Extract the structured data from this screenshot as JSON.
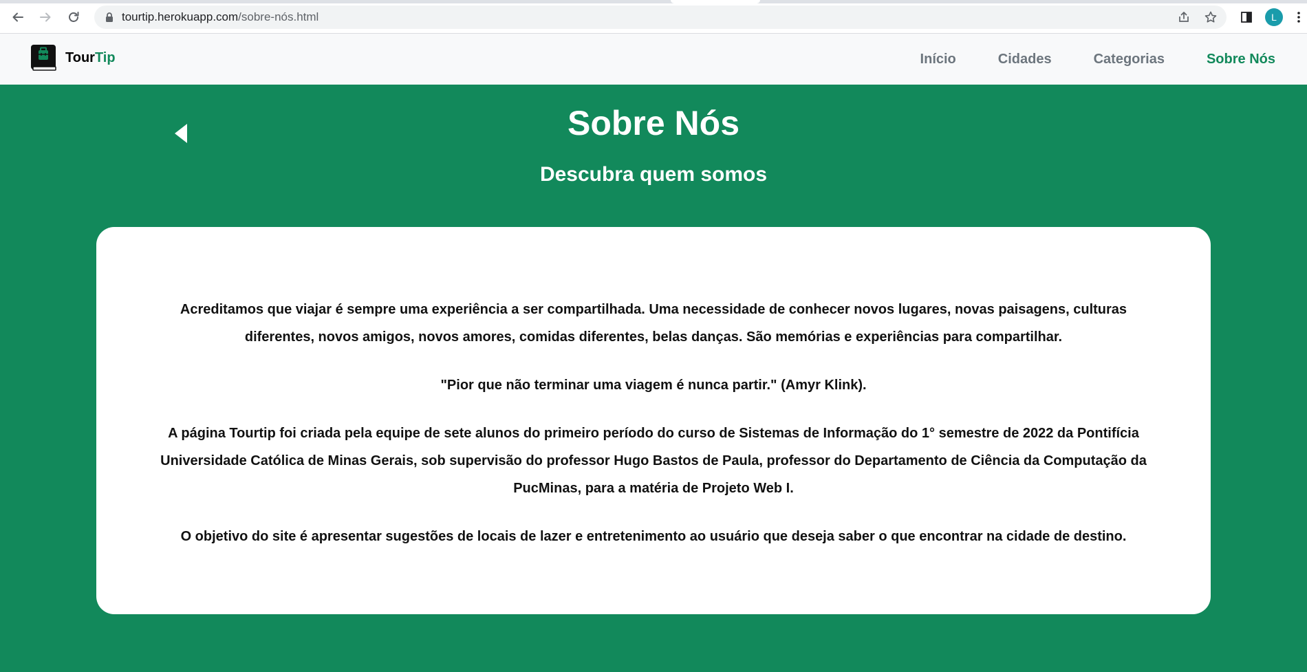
{
  "browser": {
    "url_host": "tourtip.herokuapp.com",
    "url_path": "/sobre-nós.html",
    "profile_initial": "L",
    "icons": [
      "back-icon",
      "forward-icon",
      "reload-icon",
      "lock-icon",
      "share-icon",
      "star-icon",
      "side-panel-icon",
      "menu-dots-icon"
    ]
  },
  "site": {
    "brand_main": "Tour",
    "brand_accent": "Tip",
    "accent_color": "#12895b",
    "nav": [
      {
        "label": "Início"
      },
      {
        "label": "Cidades"
      },
      {
        "label": "Categorias"
      },
      {
        "label": "Sobre Nós",
        "active": true
      }
    ]
  },
  "hero": {
    "title": "Sobre Nós",
    "subtitle": "Descubra quem somos"
  },
  "content": {
    "paragraphs": [
      "Acreditamos que viajar é sempre uma experiência a ser compartilhada. Uma necessidade de conhecer novos lugares, novas paisagens, culturas diferentes, novos amigos, novos amores, comidas diferentes, belas danças. São memórias e experiências para compartilhar.",
      "\"Pior que não terminar uma viagem é nunca partir.\" (Amyr Klink).",
      "A página Tourtip foi criada pela equipe de sete alunos do primeiro período do curso de Sistemas de Informação do 1° semestre de 2022 da Pontifícia Universidade Católica de Minas Gerais, sob supervisão do professor Hugo Bastos de Paula, professor do Departamento de Ciência da Computação da PucMinas, para a matéria de Projeto Web I.",
      "O objetivo do site é apresentar sugestões de locais de lazer e entretenimento ao usuário que deseja saber o que encontrar na cidade de destino."
    ]
  }
}
